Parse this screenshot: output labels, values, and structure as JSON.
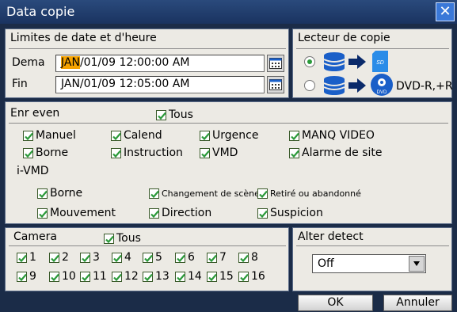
{
  "window": {
    "title": "Data copie",
    "close_glyph": "✕"
  },
  "datetime": {
    "title": "Limites de date et d'heure",
    "start_label": "Dema",
    "start_month": "JAN",
    "start_rest": "/01/09 12:00:00 AM",
    "end_label": "Fin",
    "end_value": "JAN/01/09 12:05:00 AM"
  },
  "drive": {
    "title": "Lecteur de copie",
    "options": [
      {
        "label": "",
        "selected": true,
        "icons": [
          "hdd-icon",
          "arrow-right-icon",
          "sd-card-icon"
        ]
      },
      {
        "label": "DVD-R,+R",
        "selected": false,
        "icons": [
          "hdd-icon",
          "arrow-right-icon",
          "dvd-icon"
        ]
      }
    ],
    "sd_text": "SD",
    "dvd_text": "DVD"
  },
  "events": {
    "title": "Enr even",
    "all_label": "Tous",
    "items": [
      "Manuel",
      "Calend",
      "Urgence",
      "MANQ VIDEO",
      "Borne",
      "Instruction",
      "VMD",
      "Alarme de site"
    ],
    "ivmd_title": "i-VMD",
    "ivmd_items": [
      "Borne",
      "Changement de scène",
      "Retiré ou abandonné",
      "Mouvement",
      "Direction",
      "Suspicion"
    ]
  },
  "camera": {
    "title": "Camera",
    "all_label": "Tous",
    "channels": [
      "1",
      "2",
      "3",
      "4",
      "5",
      "6",
      "7",
      "8",
      "9",
      "10",
      "11",
      "12",
      "13",
      "14",
      "15",
      "16"
    ]
  },
  "alter": {
    "title": "Alter detect",
    "selected": "Off"
  },
  "buttons": {
    "ok": "OK",
    "cancel": "Annuler"
  },
  "colors": {
    "panel": "#eceae4",
    "frame": "#1b2c48",
    "highlight": "#f7a300",
    "check": "#2b9a3a",
    "icon_blue": "#1a5fc8"
  }
}
